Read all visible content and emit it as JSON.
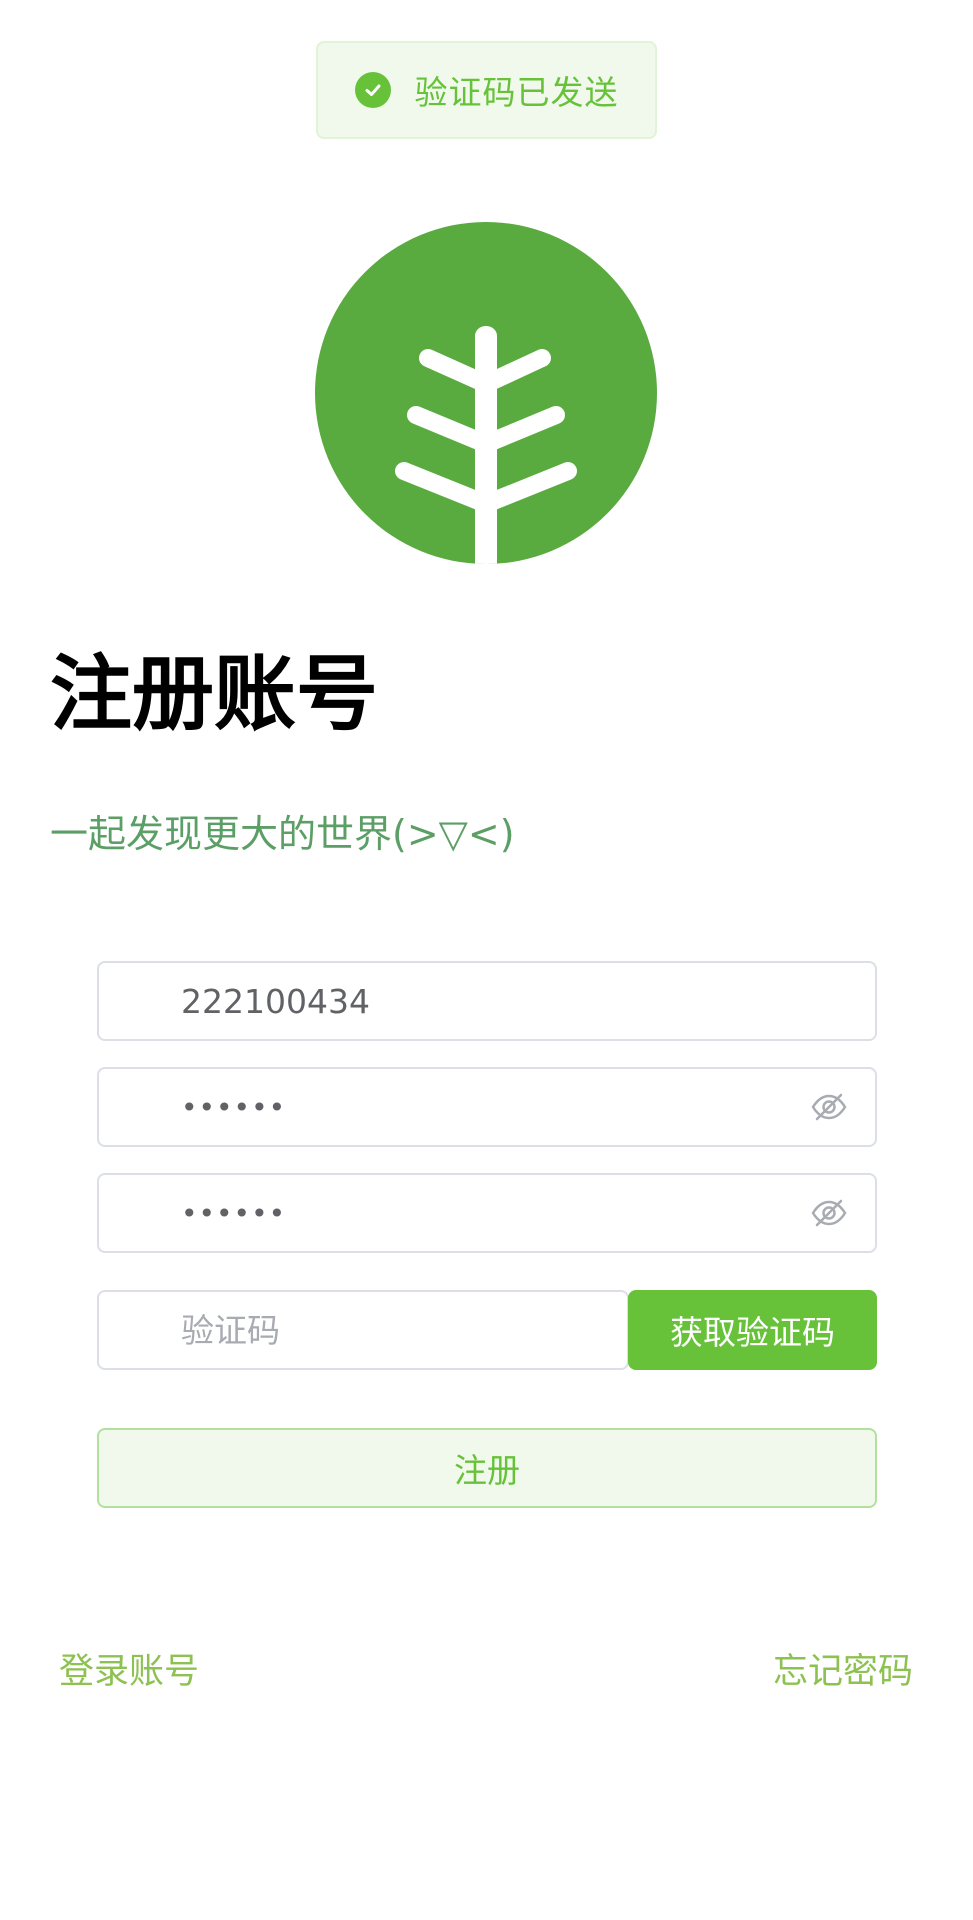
{
  "toast": {
    "icon": "check-circle-icon",
    "message": "验证码已发送",
    "color": "#67c23a"
  },
  "logo": {
    "icon": "tree-logo-icon",
    "color": "#59ab3f"
  },
  "header": {
    "title": "注册账号",
    "subtitle": "一起发现更大的世界(>▽<)"
  },
  "form": {
    "username": {
      "value": "222100434"
    },
    "password": {
      "value": "••••••",
      "icon": "eye-off-icon"
    },
    "confirm_password": {
      "value": "••••••",
      "icon": "eye-off-icon"
    },
    "code": {
      "value": "",
      "placeholder": "验证码"
    },
    "get_code_label": "获取验证码",
    "register_label": "注册"
  },
  "footer": {
    "login_link": "登录账号",
    "forgot_link": "忘记密码"
  },
  "colors": {
    "accent": "#67c23a",
    "subtitle": "#5b9e66",
    "link": "#8dc151"
  }
}
